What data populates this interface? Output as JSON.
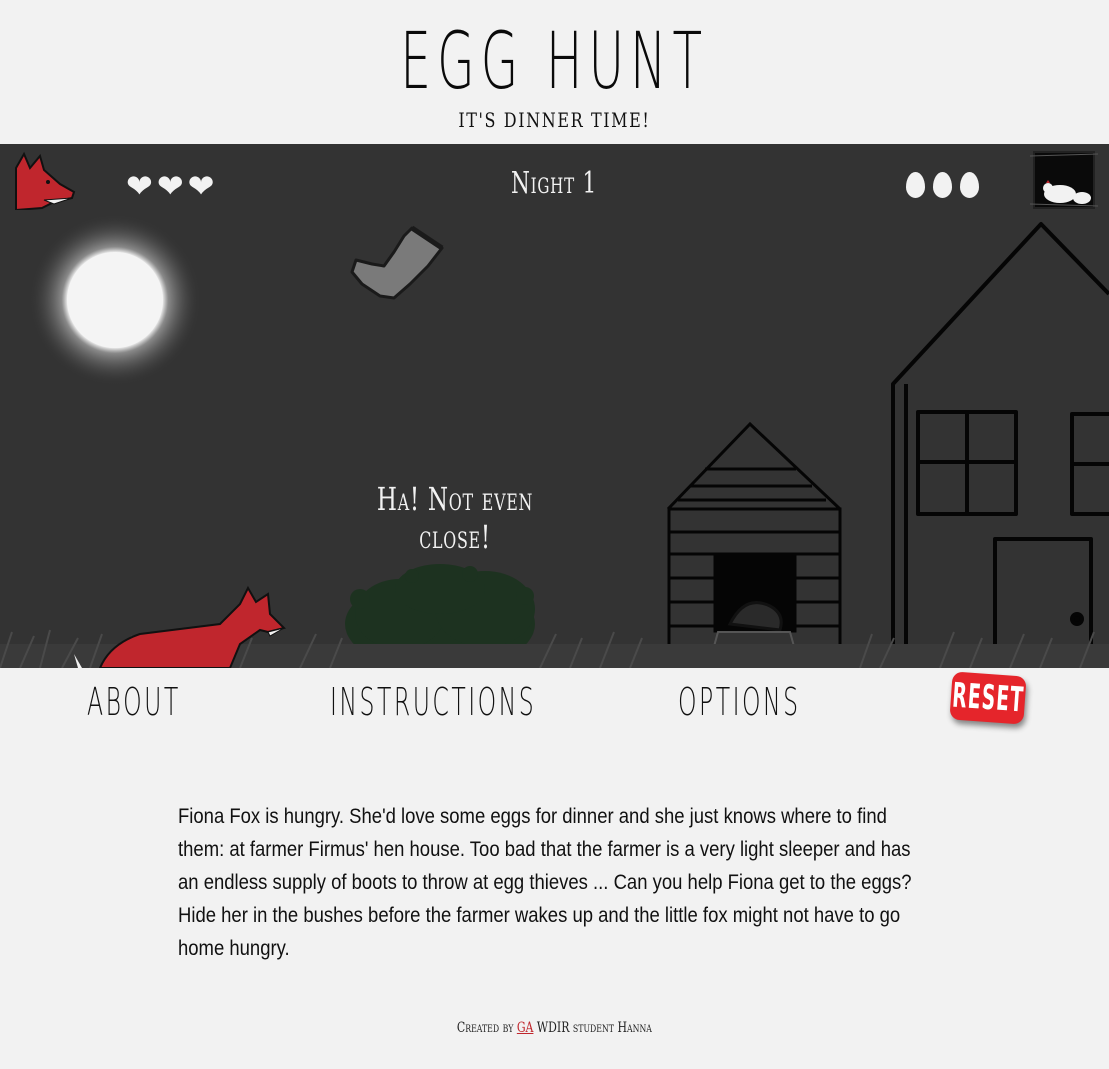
{
  "header": {
    "title": "EGG HUNT",
    "subtitle": "IT'S DINNER TIME!"
  },
  "hud": {
    "night_label": "Night 1",
    "lives": [
      "❤",
      "❤",
      "❤"
    ],
    "eggs_remaining": 3,
    "fox_icon": "fox-portrait-icon",
    "coop_icon": "hen-house-window-icon"
  },
  "game": {
    "message": "Ha! Not even close!"
  },
  "nav": {
    "about": "ABOUT",
    "instructions": "INSTRUCTIONS",
    "options": "OPTIONS",
    "reset": "RESET"
  },
  "about": {
    "text": "Fiona Fox is hungry. She'd love some eggs for dinner and she just knows where to find them: at farmer Firmus' hen house. Too bad that the farmer is a very light sleeper and has an endless supply of boots to throw at egg thieves ... Can you help Fiona get to the eggs? Hide her in the bushes before the farmer wakes up and the little fox might not have to go home hungry."
  },
  "footer": {
    "prefix": "Created by",
    "link": "GA",
    "suffix": "WDIR student Hanna"
  },
  "colors": {
    "stage_bg": "#333333",
    "page_bg": "#f2f2f2",
    "fox_red": "#c0262d",
    "reset_red": "#e5252b"
  }
}
